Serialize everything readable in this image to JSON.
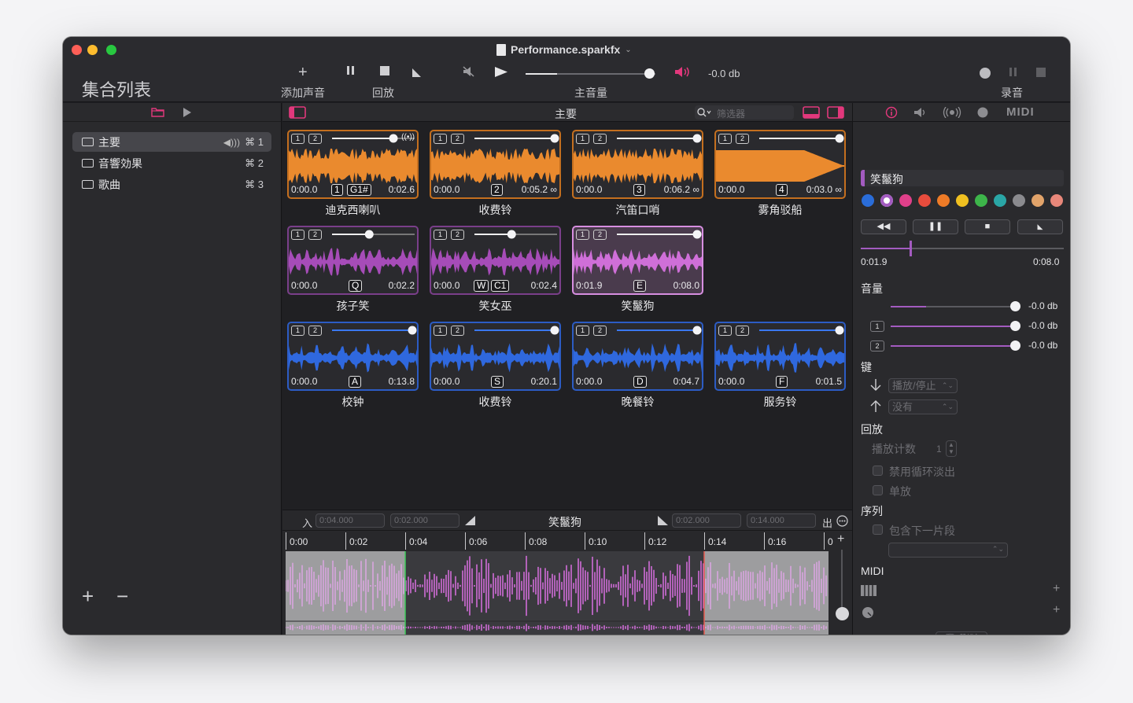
{
  "window": {
    "document_title": "Performance.sparkfx",
    "traffic_colors": [
      "#fe5f57",
      "#febc2e",
      "#28c840"
    ]
  },
  "toolbar": {
    "collection_list_title": "集合列表",
    "add_sound_label": "添加声音",
    "playback_label": "回放",
    "master_volume_label": "主音量",
    "master_volume_db": "-0.0 db",
    "master_volume_level": 0.95,
    "record_label": "录音"
  },
  "sidebar": {
    "items": [
      {
        "label": "主要",
        "shortcut": "⌘ 1",
        "selected": true
      },
      {
        "label": "音響効果",
        "shortcut": "⌘ 2",
        "selected": false
      },
      {
        "label": "歌曲",
        "shortcut": "⌘ 3",
        "selected": false
      }
    ],
    "add_label": "+",
    "remove_label": "−"
  },
  "center": {
    "header_title": "主要",
    "filter_placeholder": "筛选器",
    "tiles": [
      {
        "name": "迪克西喇叭",
        "start": "0:00.0",
        "key": "1",
        "key2": "G1#",
        "end": "0:02.6",
        "color": "orange",
        "level": 0.8,
        "loop": false
      },
      {
        "name": "收费铃",
        "start": "0:00.0",
        "key": "2",
        "key2": "",
        "end": "0:05.2 ∞",
        "color": "orange",
        "level": 1.0,
        "loop": true
      },
      {
        "name": "汽笛口哨",
        "start": "0:00.0",
        "key": "3",
        "key2": "",
        "end": "0:06.2 ∞",
        "color": "orange",
        "level": 1.0,
        "loop": true
      },
      {
        "name": "雾角驳船",
        "start": "0:00.0",
        "key": "4",
        "key2": "",
        "end": "0:03.0 ∞",
        "color": "orange",
        "level": 1.0,
        "loop": true
      },
      {
        "name": "孩子笑",
        "start": "0:00.0",
        "key": "Q",
        "key2": "",
        "end": "0:02.2",
        "color": "purple",
        "level": 0.45,
        "loop": false
      },
      {
        "name": "笑女巫",
        "start": "0:00.0",
        "key": "W",
        "key2": "C1",
        "end": "0:02.4",
        "color": "purple",
        "level": 0.45,
        "loop": false
      },
      {
        "name": "笑鬣狗",
        "start": "0:01.9",
        "key": "E",
        "key2": "",
        "end": "0:08.0",
        "color": "selected",
        "level": 1.0,
        "loop": false
      },
      {
        "name": "校钟",
        "start": "0:00.0",
        "key": "A",
        "key2": "",
        "end": "0:13.8",
        "color": "blue",
        "level": 1.0,
        "loop": false
      },
      {
        "name": "收费铃",
        "start": "0:00.0",
        "key": "S",
        "key2": "",
        "end": "0:20.1",
        "color": "blue",
        "level": 1.0,
        "loop": false
      },
      {
        "name": "晚餐铃",
        "start": "0:00.0",
        "key": "D",
        "key2": "",
        "end": "0:04.7",
        "color": "blue",
        "level": 1.0,
        "loop": false
      },
      {
        "name": "服务铃",
        "start": "0:00.0",
        "key": "F",
        "key2": "",
        "end": "0:01.5",
        "color": "blue",
        "level": 1.0,
        "loop": false
      }
    ],
    "channel_1": "1",
    "channel_2": "2"
  },
  "editor": {
    "in_label": "入",
    "in_value_1": "0:04.000",
    "in_value_2": "0:02.000",
    "title": "笑鬣狗",
    "out_value_1": "0:02.000",
    "out_value_2": "0:14.000",
    "out_label": "出",
    "ruler": [
      "0:00",
      "0:02",
      "0:04",
      "0:06",
      "0:08",
      "0:10",
      "0:12",
      "0:14",
      "0:16",
      "0"
    ]
  },
  "inspector": {
    "sound_name": "笑鬣狗",
    "midi_tab": "MIDI",
    "colors": [
      "#2a6dd9",
      "#a35bc0",
      "#e0408a",
      "#e84c3d",
      "#ee7b27",
      "#f0c020",
      "#3db54a",
      "#2aa6a6",
      "#8a8a8e",
      "#e1a36a",
      "#e8877a"
    ],
    "elapsed": "0:01.9",
    "total": "0:08.0",
    "playhead_fraction": 0.24,
    "volume_label": "音量",
    "volume_db_main": "-0.0 db",
    "volume_db_ch1": "-0.0 db",
    "volume_db_ch2": "-0.0 db",
    "ch1": "1",
    "ch2": "2",
    "keys_label": "键",
    "key_down_action": "播放/停止",
    "key_up_action": "没有",
    "playback_label": "回放",
    "play_count_label": "播放计数",
    "play_count_value": "1",
    "disable_loop_fade_label": "禁用循环淡出",
    "solo_label": "单放",
    "sequence_label": "序列",
    "include_next_label": "包含下一片段",
    "midi_label": "MIDI",
    "delete_label": "删除"
  }
}
